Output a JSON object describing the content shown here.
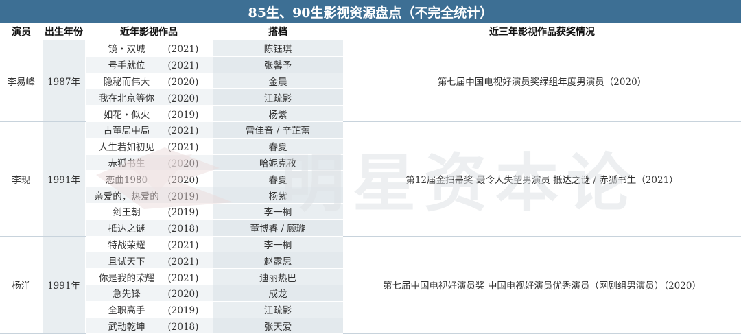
{
  "title": "85生、90生影视资源盘点（不完全统计）",
  "headers": [
    "演员",
    "出生年份",
    "近年影视作品",
    "搭档",
    "近三年影视作品获奖情况"
  ],
  "actors": [
    {
      "name": "李易峰",
      "birth": "1987年",
      "award": "第七届中国电视好演员奖绿组年度男演员（2020）",
      "works": [
        {
          "title": "镜・双城",
          "year": "(2021)",
          "partner": "陈钰琪"
        },
        {
          "title": "号手就位",
          "year": "(2021)",
          "partner": "张馨予"
        },
        {
          "title": "隐秘而伟大",
          "year": "(2020)",
          "partner": "金晨"
        },
        {
          "title": "我在北京等你",
          "year": "(2020)",
          "partner": "江疏影"
        },
        {
          "title": "如花・似火",
          "year": "(2019)",
          "partner": "杨紫"
        }
      ]
    },
    {
      "name": "李现",
      "birth": "1991年",
      "award": "第12届金扫帚奖 最令人失望男演员 抵达之谜 / 赤狐书生（2021）",
      "works": [
        {
          "title": "古董局中局",
          "year": "(2021)",
          "partner": "雷佳音 / 辛芷蕾"
        },
        {
          "title": "人生若如初见",
          "year": "(2021)",
          "partner": "春夏"
        },
        {
          "title": "赤狐书生",
          "year": "(2020)",
          "partner": "哈妮克孜"
        },
        {
          "title": "恋曲1980",
          "year": "(2020)",
          "partner": "春夏"
        },
        {
          "title": "亲爱的，热爱的",
          "year": "(2019)",
          "partner": "杨紫"
        },
        {
          "title": "剑王朝",
          "year": "(2019)",
          "partner": "李一桐"
        },
        {
          "title": "抵达之谜",
          "year": "(2018)",
          "partner": "董博睿 / 顾璇"
        }
      ]
    },
    {
      "name": "杨洋",
      "birth": "1991年",
      "award": "第七届中国电视好演员奖 中国电视好演员优秀演员（网剧组男演员）（2020）",
      "works": [
        {
          "title": "特战荣耀",
          "year": "(2021)",
          "partner": "李一桐"
        },
        {
          "title": "且试天下",
          "year": "(2021)",
          "partner": "赵露思"
        },
        {
          "title": "你是我的荣耀",
          "year": "(2021)",
          "partner": "迪丽热巴"
        },
        {
          "title": "急先锋",
          "year": "(2020)",
          "partner": "成龙"
        },
        {
          "title": "全职高手",
          "year": "(2019)",
          "partner": "江疏影"
        },
        {
          "title": "武动乾坤",
          "year": "(2018)",
          "partner": "张天爱"
        }
      ]
    }
  ],
  "watermark": {
    "text": "明星资本论",
    "color": "#dfe3e6"
  },
  "colors": {
    "title_bg": "#3d6f94",
    "band": "#e9eef1",
    "band_alt": "#f1f4f6"
  }
}
